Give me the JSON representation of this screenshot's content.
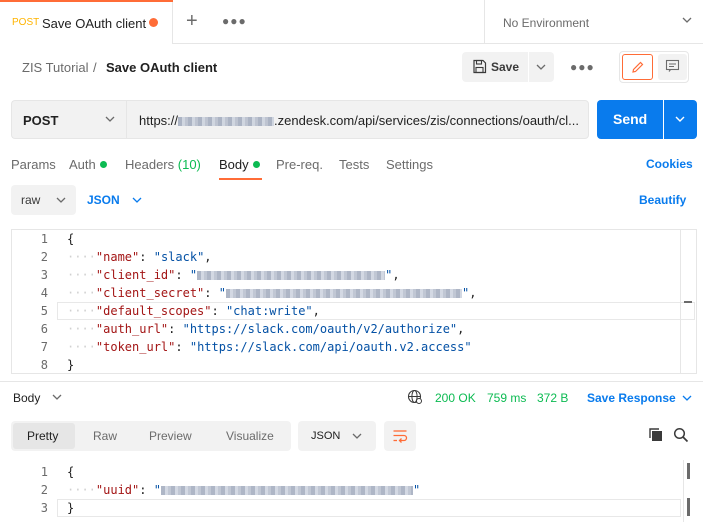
{
  "tab": {
    "method": "POST",
    "title": "Save OAuth client"
  },
  "environment": {
    "label": "No Environment"
  },
  "breadcrumb": {
    "parent": "ZIS Tutorial",
    "separator": "/",
    "current": "Save OAuth client"
  },
  "toolbar": {
    "save_label": "Save"
  },
  "request": {
    "method": "POST",
    "url_prefix": "https://",
    "url_suffix": ".zendesk.com/api/services/zis/connections/oauth/cl...",
    "send_label": "Send"
  },
  "request_tabs": [
    {
      "label": "Params"
    },
    {
      "label": "Auth"
    },
    {
      "label": "Headers",
      "count": "(10)"
    },
    {
      "label": "Body"
    },
    {
      "label": "Pre-req."
    },
    {
      "label": "Tests"
    },
    {
      "label": "Settings"
    }
  ],
  "cookies_label": "Cookies",
  "body_options": {
    "mode": "raw",
    "language": "JSON",
    "beautify": "Beautify"
  },
  "request_body": {
    "line_numbers": [
      "1",
      "2",
      "3",
      "4",
      "5",
      "6",
      "7",
      "8"
    ],
    "open_brace": "{",
    "close_brace": "}",
    "fields": [
      {
        "key": "\"name\"",
        "value": "\"slack\""
      },
      {
        "key": "\"client_id\"",
        "value": "\""
      },
      {
        "key": "\"client_secret\"",
        "value": "\""
      },
      {
        "key": "\"default_scopes\"",
        "value": "\"chat:write\""
      },
      {
        "key": "\"auth_url\"",
        "value": "\"https://slack.com/oauth/v2/authorize\""
      },
      {
        "key": "\"token_url\"",
        "value": "\"https://slack.com/api/oauth.v2.access\""
      }
    ]
  },
  "response": {
    "section_label": "Body",
    "status": "200 OK",
    "time": "759 ms",
    "size": "372 B",
    "save_label": "Save Response",
    "view_modes": [
      "Pretty",
      "Raw",
      "Preview",
      "Visualize"
    ],
    "format": "JSON",
    "line_numbers": [
      "1",
      "2",
      "3"
    ],
    "open_brace": "{",
    "close_brace": "}",
    "field_key": "\"uuid\"",
    "field_value_quote": "\""
  },
  "colors": {
    "accent": "#ff6c37",
    "primary": "#097bed",
    "success": "#0cbb52",
    "method_post_tab": "#ffb400"
  }
}
